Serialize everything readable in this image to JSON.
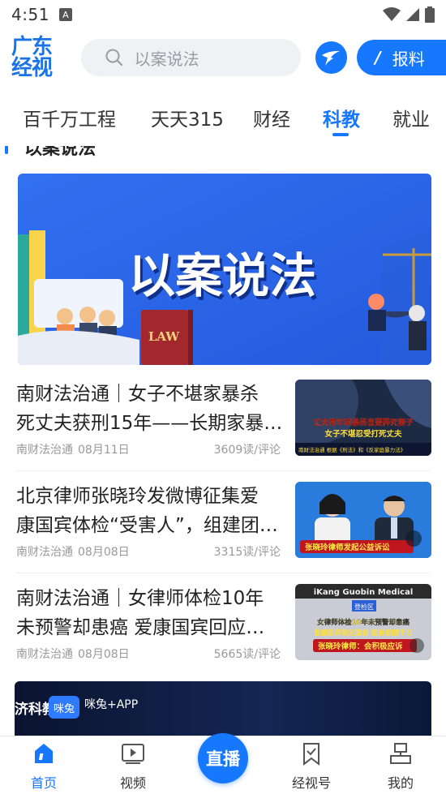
{
  "status_bar": {
    "time": "4:51",
    "notif_letter": "A"
  },
  "header": {
    "logo_line1": "广东",
    "logo_line2": "经视",
    "search_placeholder": "以案说法",
    "report_label": "报料",
    "report_icon_letter": "/"
  },
  "tabs": [
    {
      "label": "百千万工程",
      "active": false
    },
    {
      "label": "天天315",
      "active": false
    },
    {
      "label": "财经",
      "active": false
    },
    {
      "label": "科教",
      "active": true
    },
    {
      "label": "就业",
      "active": false
    }
  ],
  "section": {
    "title": "以案说法"
  },
  "banner": {
    "title": "以案说法",
    "book_text": "LAW"
  },
  "articles": [
    {
      "title_line1": "南财法治通｜女子不堪家暴杀",
      "title_line2": "死丈夫获刑15年——长期家暴…",
      "source": "南财法治通",
      "date": "08月11日",
      "reads": "3609读/评论",
      "thumb_line1": "丈夫常年家暴扬言要弄死妻子",
      "thumb_line2": "女子不堪忍受打死丈夫",
      "thumb_caption": "南财法治通 根据《刑法》和《反家庭暴力法》"
    },
    {
      "title_line1": "北京律师张晓玲发微博征集爱",
      "title_line2": "康国宾体检“受害人”，组建团…",
      "source": "南财法治通",
      "date": "08月08日",
      "reads": "3315读/评论",
      "thumb_caption": "张晓玲律师发起公益诉讼"
    },
    {
      "title_line1": "南财法治通｜女律师体检10年",
      "title_line2": "未预警却患癌 爱康国宾回应…",
      "source": "南财法治通",
      "date": "08月08日",
      "reads": "5665读/评论",
      "thumb_sign": "iKang Guobin Medical",
      "thumb_plate": "登检区",
      "thumb_line1": "女律师体检10年未预警却患癌",
      "thumb_line2": "爱康国宾称无漏诊 起诉索赔千万",
      "thumb_caption": "张晓玲律师：会积极应诉"
    }
  ],
  "ad": {
    "left_text": "济科教",
    "logo_text": "咪兔",
    "app_text": "咪兔+APP"
  },
  "bottom_nav": {
    "home": "首页",
    "video": "视频",
    "live": "直播",
    "jingshi": "经视号",
    "mine": "我的"
  },
  "colors": {
    "accent": "#1677ff",
    "text": "#222222",
    "meta": "#999999"
  }
}
